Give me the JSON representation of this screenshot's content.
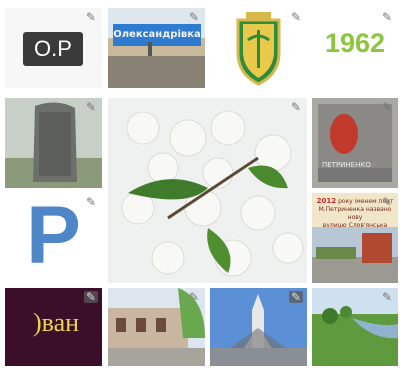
{
  "gallery": {
    "edit_icon_glyph": "✎",
    "tiles": [
      {
        "name": "op-logo-thumb",
        "text": "O.P"
      },
      {
        "name": "town-sign-thumb",
        "text": "Олександрівка"
      },
      {
        "name": "coat-of-arms-thumb"
      },
      {
        "name": "year-1962-thumb",
        "text": "1962"
      },
      {
        "name": "memorial-stone-thumb"
      },
      {
        "name": "cherry-blossom-thumb"
      },
      {
        "name": "memorial-plaque-thumb",
        "text": "ПЕТРИНЕНКО"
      },
      {
        "name": "letter-p-thumb",
        "text": "P"
      },
      {
        "name": "street-sign-thumb",
        "year": "2012",
        "text_line1": "року іменем поет",
        "text_line2": "М.Петриненка названо нову",
        "text_line3": "вулицю Слов'янська"
      },
      {
        "name": "ivan-text-thumb",
        "text": ")ван"
      },
      {
        "name": "school-building-thumb"
      },
      {
        "name": "rocket-monument-thumb"
      },
      {
        "name": "river-landscape-thumb"
      }
    ]
  },
  "colors": {
    "year_green": "#8dc63f",
    "letter_blue": "#4e86c8",
    "ivan_yellow": "#e9d34a",
    "plaque_red": "#c0392b"
  }
}
